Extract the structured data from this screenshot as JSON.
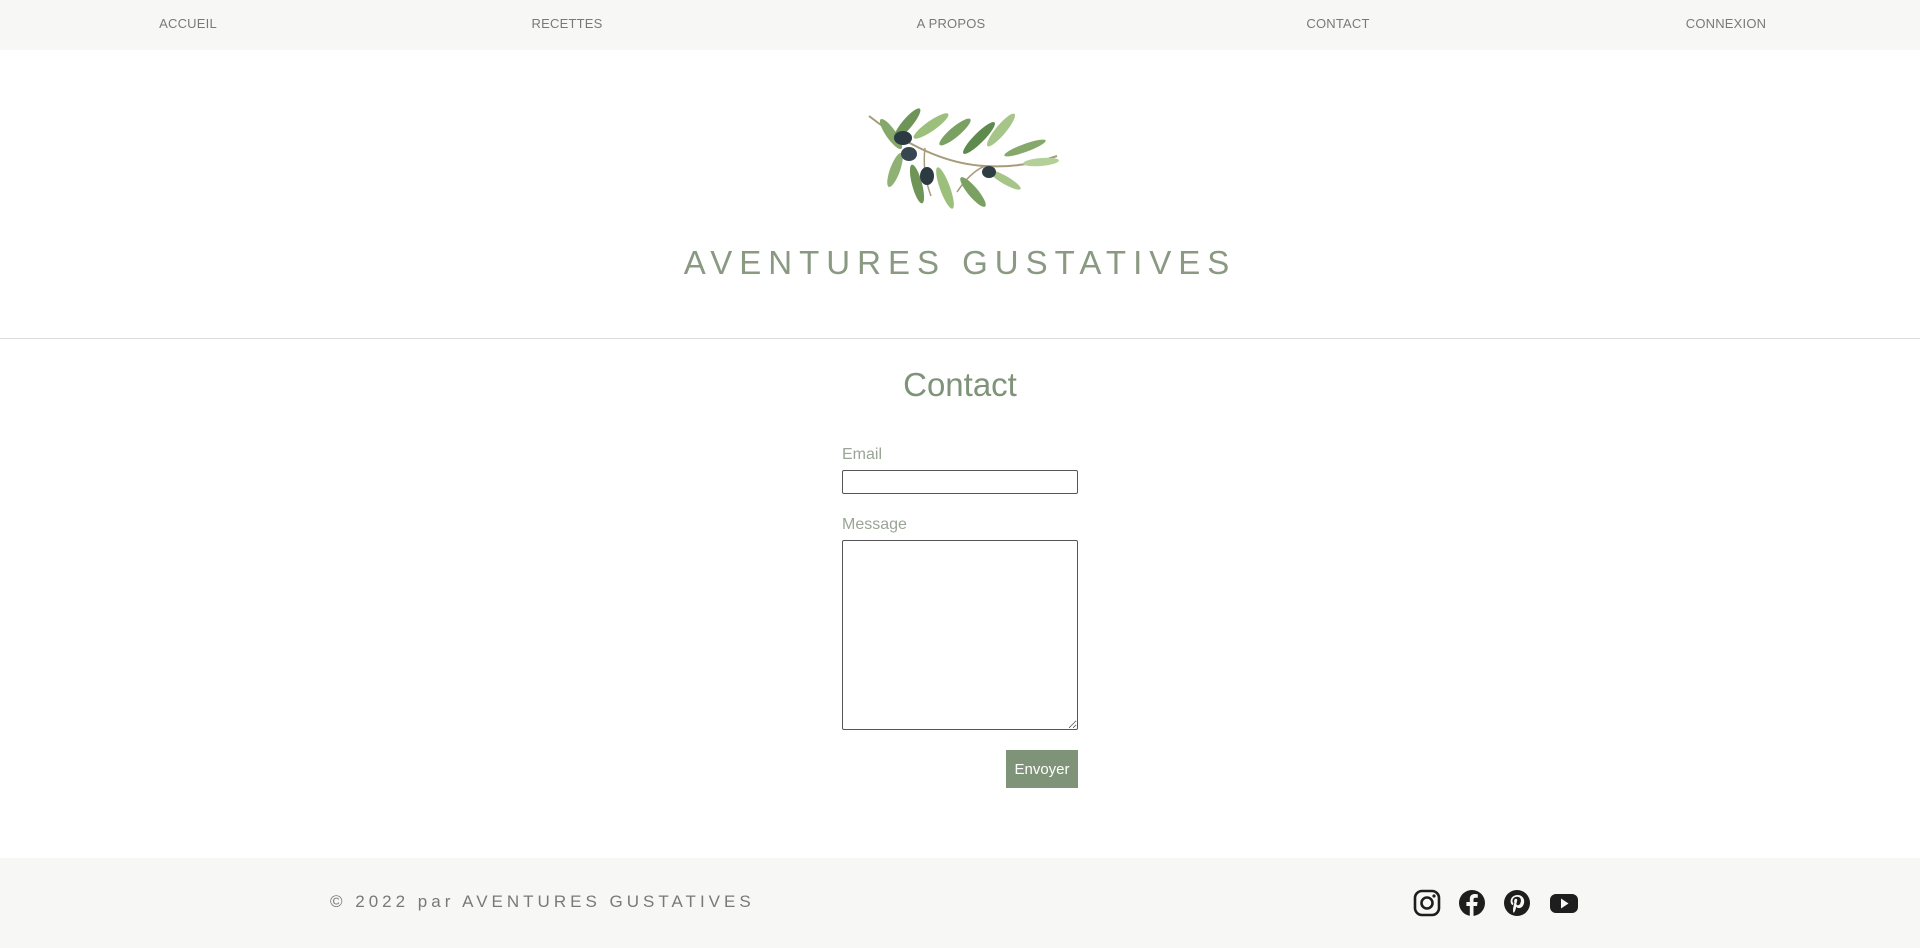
{
  "nav": {
    "items": [
      {
        "label": "ACCUEIL"
      },
      {
        "label": "RECETTES"
      },
      {
        "label": "A PROPOS"
      },
      {
        "label": "CONTACT"
      },
      {
        "label": "CONNEXION"
      }
    ]
  },
  "header": {
    "logo_icon": "olive-branch-icon",
    "site_title": "AVENTURES GUSTATIVES"
  },
  "contact": {
    "title": "Contact",
    "email_label": "Email",
    "email_value": "",
    "message_label": "Message",
    "message_value": "",
    "submit_label": "Envoyer"
  },
  "footer": {
    "copyright": "© 2022 par AVENTURES GUSTATIVES",
    "social_icons": [
      "instagram-icon",
      "facebook-icon",
      "pinterest-icon",
      "youtube-icon"
    ]
  },
  "colors": {
    "accent": "#7f9378",
    "title": "#8a9a82",
    "nav_text": "#7a7a74",
    "band_background": "#f7f7f5",
    "icon": "#1e1e1e"
  }
}
